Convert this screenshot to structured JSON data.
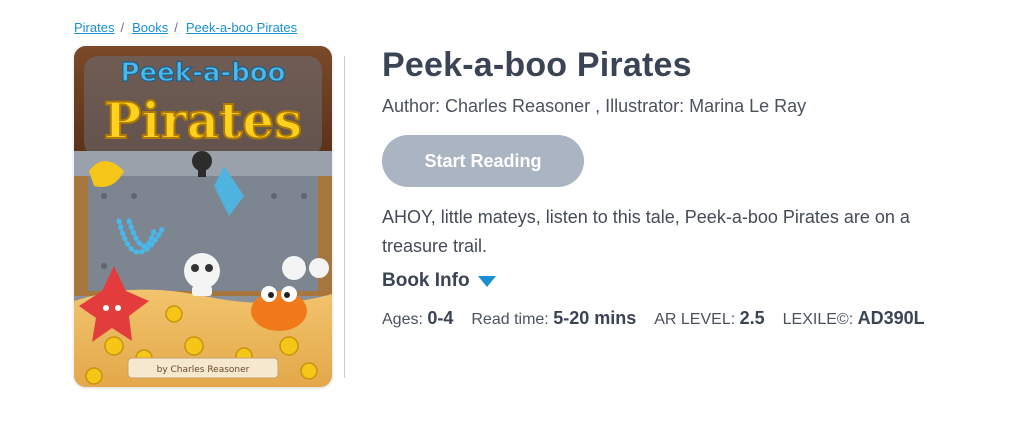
{
  "breadcrumb": {
    "items": [
      "Pirates",
      "Books",
      "Peek-a-boo Pirates"
    ],
    "separator": "/"
  },
  "cover": {
    "alt": "Peek-a-boo Pirates book cover",
    "title_top": "Peek-a-boo",
    "title_main": "Pirates",
    "byline": "by Charles Reasoner"
  },
  "book": {
    "title": "Peek-a-boo Pirates",
    "credits": "Author: Charles Reasoner , Illustrator: Marina Le Ray",
    "start_label": "Start Reading",
    "description": "AHOY, little mateys, listen to this tale, Peek-a-boo Pirates are on a treasure trail.",
    "info_label": "Book Info"
  },
  "stats": {
    "ages_label": "Ages:",
    "ages_value": "0-4",
    "read_label": "Read time:",
    "read_value": "5-20 mins",
    "ar_label": "AR LEVEL:",
    "ar_value": "2.5",
    "lexile_label": "LEXILE©:",
    "lexile_value": "AD390L"
  },
  "colors": {
    "accent": "#1a8fd1",
    "button_disabled": "#aab4c3",
    "title": "#3a4454"
  },
  "icons": {
    "info_toggle": "caret-down-icon"
  }
}
